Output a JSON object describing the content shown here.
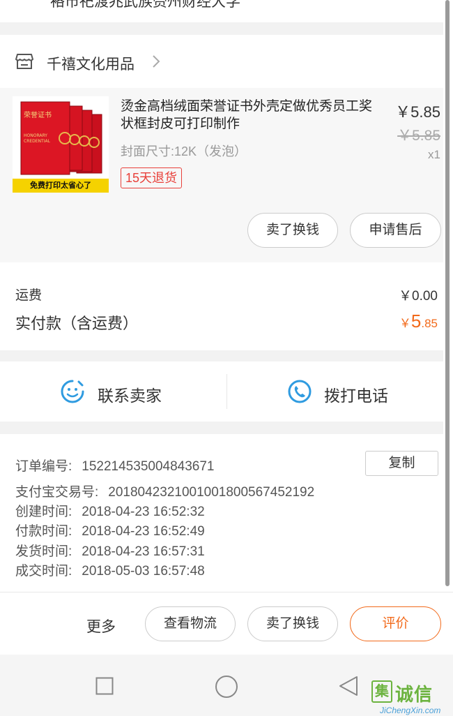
{
  "top": {
    "cut_text": "袼市祀渡兆武族赍州财经大学"
  },
  "shop": {
    "name": "千禧文化用品"
  },
  "item": {
    "title": "烫金高档绒面荣誉证书外壳定做优秀员工奖状框封皮可打印制作",
    "spec": "封面尺寸:12K（发泡）",
    "return_tag": "15天退货",
    "price": "￥5.85",
    "original_price": "￥5.85",
    "quantity": "x1",
    "image_banner": "免费打印太省心了",
    "image_caption": "荣誉证书",
    "image_en_1": "HONORARY",
    "image_en_2": "CREDENTIAL",
    "button_resell": "卖了换钱",
    "button_aftersale": "申请售后"
  },
  "fees": {
    "shipping_label": "运费",
    "shipping_value": "￥0.00",
    "paid_label": "实付款（含运费）",
    "paid_currency": "￥",
    "paid_int": "5",
    "paid_dec": ".85"
  },
  "contact": {
    "seller_label": "联系卖家",
    "call_label": "拨打电话"
  },
  "order_info": {
    "order_no_label": "订单编号:",
    "order_no": "152214535004843671",
    "copy_label": "复制",
    "alipay_label": "支付宝交易号:",
    "alipay_no": "2018042321001001800567452192",
    "created_label": "创建时间:",
    "created": "2018-04-23 16:52:32",
    "paid_label": "付款时间:",
    "paid": "2018-04-23 16:52:49",
    "shipped_label": "发货时间:",
    "shipped": "2018-04-23 16:57:31",
    "closed_label": "成交时间:",
    "closed": "2018-05-03 16:57:48"
  },
  "actions": {
    "more": "更多",
    "logistics": "查看物流",
    "resell": "卖了换钱",
    "review": "评价"
  },
  "watermark": {
    "cn": "诚信",
    "logo": "集",
    "en": "JiChengXin.com"
  },
  "colors": {
    "accent": "#f26a1b",
    "tag_red": "#e8403a",
    "icon_blue": "#2f9be0",
    "watermark_green": "#6cb33f"
  },
  "icons": {
    "shop": "store-icon",
    "chevron": "chevron-right-icon",
    "seller": "chat-smile-icon",
    "phone": "phone-icon",
    "nav_recent": "square-icon",
    "nav_home": "circle-icon",
    "nav_back": "triangle-back-icon"
  }
}
